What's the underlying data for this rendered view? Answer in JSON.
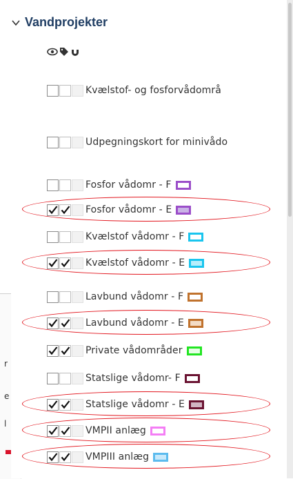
{
  "group": {
    "title": "Vandprojekter"
  },
  "toolbar_icons": [
    "eye-icon",
    "tag-icon",
    "magnet-icon"
  ],
  "layers": [
    {
      "label": "Kvælstof- og fosforvådområ",
      "checked": [
        false,
        false
      ],
      "swatch": null,
      "highlighted": false
    },
    {
      "label": "Udpegningskort for minivådo",
      "checked": [
        false,
        false
      ],
      "swatch": null,
      "highlighted": false
    },
    {
      "label": "Fosfor vådomr - F",
      "checked": [
        false,
        false
      ],
      "swatch": {
        "border": "#9b4ec9",
        "fill": "#ffffff"
      },
      "highlighted": false
    },
    {
      "label": "Fosfor vådomr - E",
      "checked": [
        true,
        true
      ],
      "swatch": {
        "border": "#9b4ec9",
        "fill": "#c9b3e6"
      },
      "highlighted": true
    },
    {
      "label": "Kvælstof vådomr - F",
      "checked": [
        false,
        false
      ],
      "swatch": {
        "border": "#19c5ee",
        "fill": "#ffffff"
      },
      "highlighted": false
    },
    {
      "label": "Kvælstof vådomr - E",
      "checked": [
        true,
        true
      ],
      "swatch": {
        "border": "#19c5ee",
        "fill": "#b6eefb"
      },
      "highlighted": true
    },
    {
      "label": "Lavbund vådomr - F",
      "checked": [
        false,
        false
      ],
      "swatch": {
        "border": "#c0722d",
        "fill": "#ffffff"
      },
      "highlighted": false
    },
    {
      "label": "Lavbund vådomr - E",
      "checked": [
        true,
        true
      ],
      "swatch": {
        "border": "#c0722d",
        "fill": "#f3dcc6"
      },
      "highlighted": true
    },
    {
      "label": "Private vådområder",
      "checked": [
        true,
        true
      ],
      "swatch": {
        "border": "#22e522",
        "fill": "#e6ffe6"
      },
      "highlighted": false
    },
    {
      "label": "Statslige vådomr- F",
      "checked": [
        false,
        false
      ],
      "swatch": {
        "border": "#6a1231",
        "fill": "#ffffff"
      },
      "highlighted": false
    },
    {
      "label": "Statslige vådomr - E",
      "checked": [
        true,
        true
      ],
      "swatch": {
        "border": "#6a1231",
        "fill": "#d1b4c3"
      },
      "highlighted": true
    },
    {
      "label": "VMPII anlæg",
      "checked": [
        true,
        true
      ],
      "swatch": {
        "border": "#f47ef5",
        "fill": "#ffffff"
      },
      "highlighted": true
    },
    {
      "label": "VMPIII anlæg",
      "checked": [
        true,
        true
      ],
      "swatch": {
        "border": "#5cbbee",
        "fill": "#c8e9fb"
      },
      "highlighted": true
    }
  ],
  "background_fragments": [
    "r",
    "e",
    "l"
  ],
  "colors": {
    "title": "#1f3d63",
    "highlight": "#e2141c"
  }
}
